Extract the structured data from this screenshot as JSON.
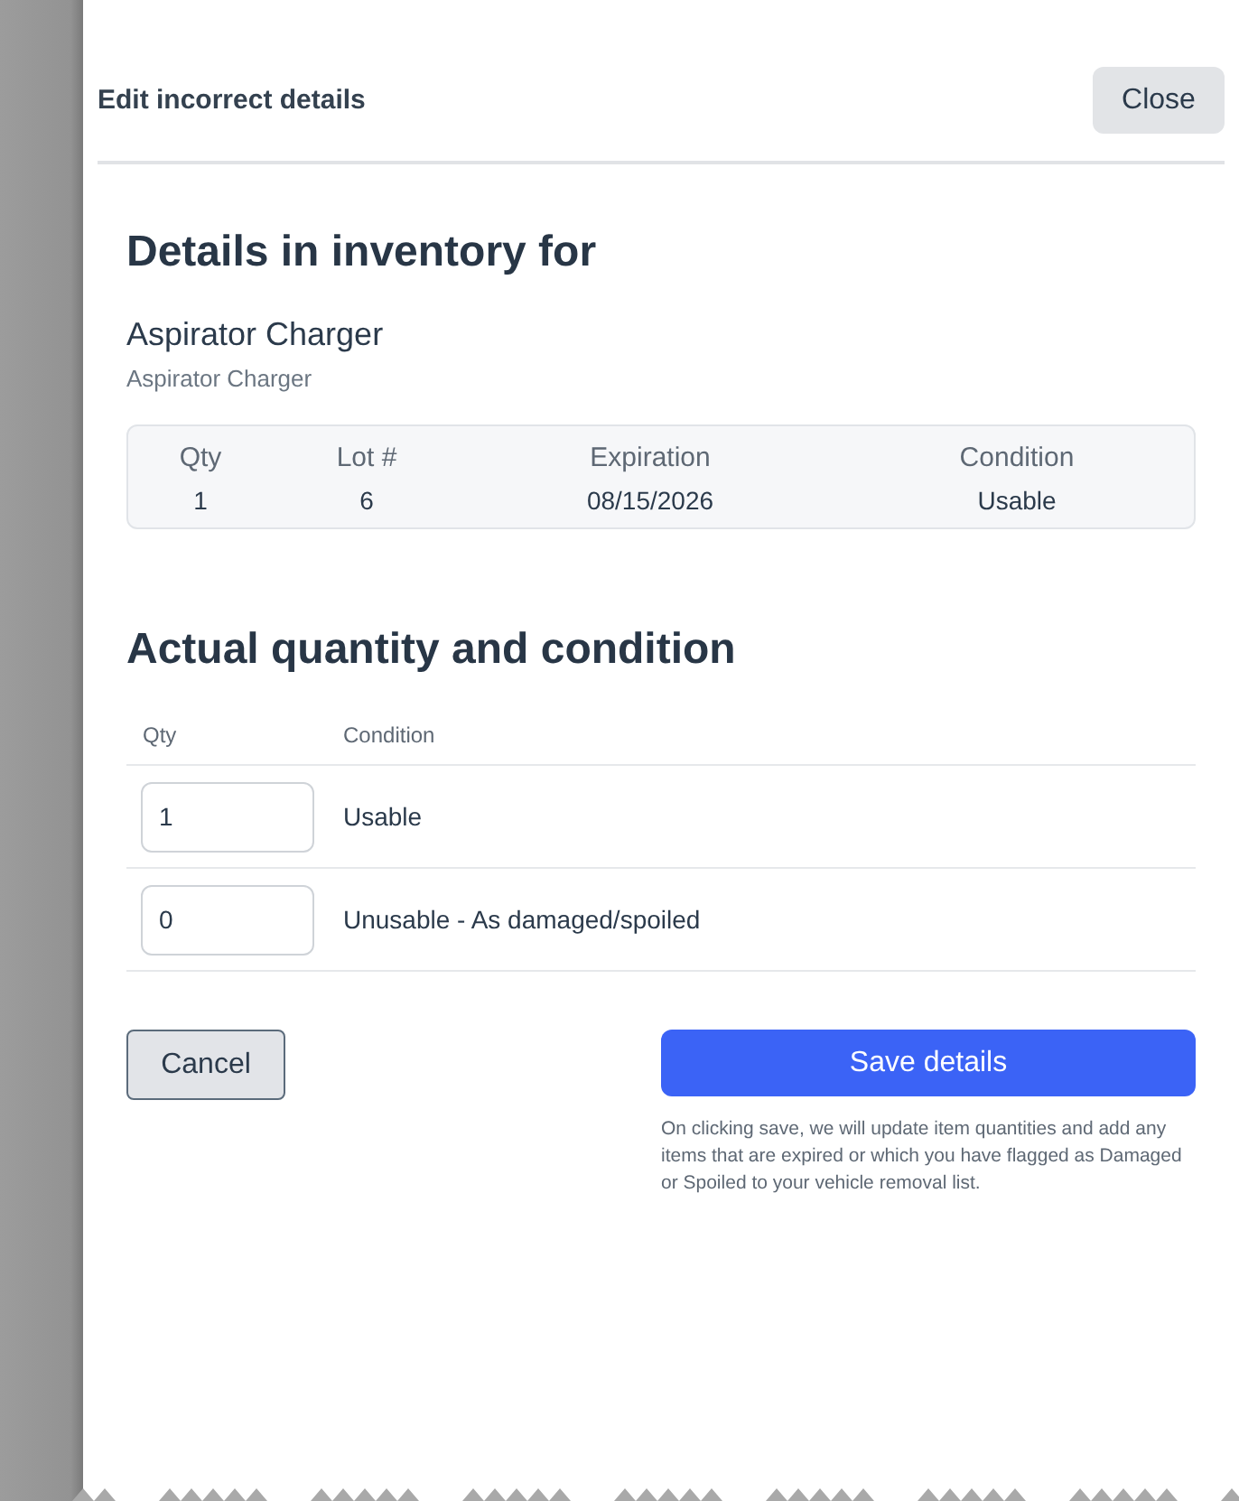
{
  "dialog": {
    "title": "Edit incorrect details",
    "close_button": "Close"
  },
  "inventory": {
    "heading": "Details in inventory for",
    "item_name": "Aspirator Charger",
    "item_subtitle": "Aspirator Charger",
    "columns": [
      "Qty",
      "Lot #",
      "Expiration",
      "Condition"
    ],
    "values": [
      "1",
      "6",
      "08/15/2026",
      "Usable"
    ]
  },
  "actual": {
    "heading": "Actual quantity and condition",
    "columns": [
      "Qty",
      "Condition"
    ],
    "rows": [
      {
        "qty": "1",
        "condition": "Usable"
      },
      {
        "qty": "0",
        "condition": "Unusable - As damaged/spoiled"
      }
    ]
  },
  "buttons": {
    "cancel": "Cancel",
    "save": "Save details"
  },
  "note": "On clicking save, we will update item quantities and add any items that are expired or which you have flagged as Damaged or Spoiled to your vehicle removal list."
}
